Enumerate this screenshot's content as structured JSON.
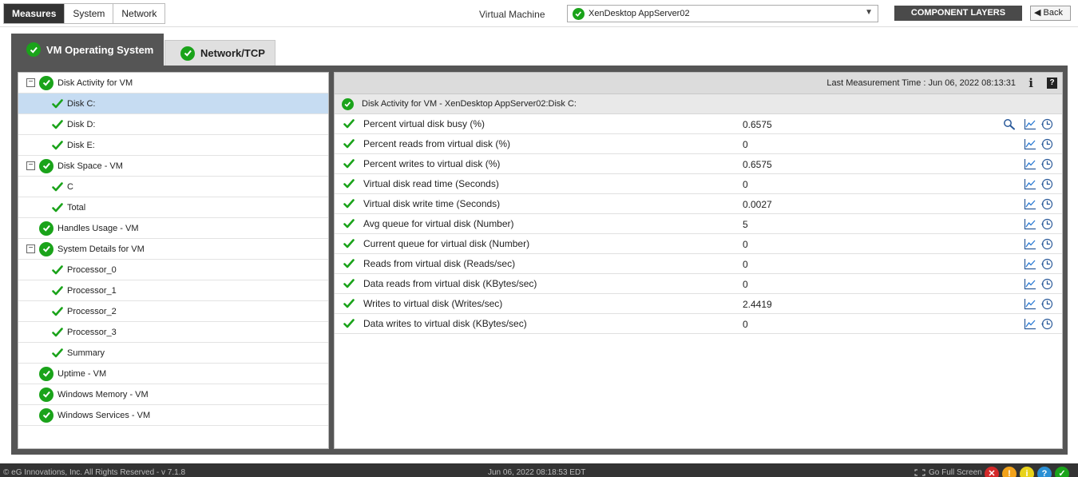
{
  "topnav": [
    "Measures",
    "System",
    "Network"
  ],
  "vm": {
    "label": "Virtual Machine",
    "selected": "XenDesktop AppServer02"
  },
  "component_layers": "COMPONENT LAYERS",
  "back": "Back",
  "tabs": [
    "VM Operating System",
    "Network/TCP"
  ],
  "tree": [
    {
      "label": "Disk Activity for VM",
      "level": 0,
      "expand": true
    },
    {
      "label": "Disk C:",
      "level": 1,
      "selected": true
    },
    {
      "label": "Disk D:",
      "level": 1
    },
    {
      "label": "Disk E:",
      "level": 1
    },
    {
      "label": "Disk Space - VM",
      "level": 0,
      "expand": true
    },
    {
      "label": "C",
      "level": 1
    },
    {
      "label": "Total",
      "level": 1
    },
    {
      "label": "Handles Usage - VM",
      "level": 0,
      "expand": false
    },
    {
      "label": "System Details for VM",
      "level": 0,
      "expand": true
    },
    {
      "label": "Processor_0",
      "level": 1
    },
    {
      "label": "Processor_1",
      "level": 1
    },
    {
      "label": "Processor_2",
      "level": 1
    },
    {
      "label": "Processor_3",
      "level": 1
    },
    {
      "label": "Summary",
      "level": 1
    },
    {
      "label": "Uptime - VM",
      "level": 0,
      "expand": false
    },
    {
      "label": "Windows Memory - VM",
      "level": 0,
      "expand": false
    },
    {
      "label": "Windows Services - VM",
      "level": 0,
      "expand": false
    }
  ],
  "panel": {
    "last_measurement": "Last Measurement Time : Jun 06, 2022 08:13:31",
    "title": "Disk Activity for VM - XenDesktop AppServer02:Disk C:",
    "measures": [
      {
        "name": "Percent virtual disk busy (%)",
        "value": "0.6575",
        "search": true
      },
      {
        "name": "Percent reads from virtual disk (%)",
        "value": "0"
      },
      {
        "name": "Percent writes to virtual disk (%)",
        "value": "0.6575"
      },
      {
        "name": "Virtual disk read time (Seconds)",
        "value": "0"
      },
      {
        "name": "Virtual disk write time (Seconds)",
        "value": "0.0027"
      },
      {
        "name": "Avg queue for virtual disk (Number)",
        "value": "5"
      },
      {
        "name": "Current queue for virtual disk (Number)",
        "value": "0"
      },
      {
        "name": "Reads from virtual disk (Reads/sec)",
        "value": "0"
      },
      {
        "name": "Data reads from virtual disk (KBytes/sec)",
        "value": "0"
      },
      {
        "name": "Writes to virtual disk (Writes/sec)",
        "value": "2.4419"
      },
      {
        "name": "Data writes to virtual disk (KBytes/sec)",
        "value": "0"
      }
    ]
  },
  "footer": {
    "copyright": "© eG Innovations, Inc. All Rights Reserved - v 7.1.8",
    "time": "Jun 06, 2022 08:18:53 EDT",
    "fullscreen": "Go Full Screen",
    "alarms": [
      {
        "glyph": "✕",
        "color": "#d42a2a"
      },
      {
        "glyph": "!",
        "color": "#f2a21a"
      },
      {
        "glyph": "i",
        "color": "#e8d21a"
      },
      {
        "glyph": "?",
        "color": "#2a8fd4"
      },
      {
        "glyph": "✓",
        "color": "#1aa31a"
      }
    ]
  }
}
